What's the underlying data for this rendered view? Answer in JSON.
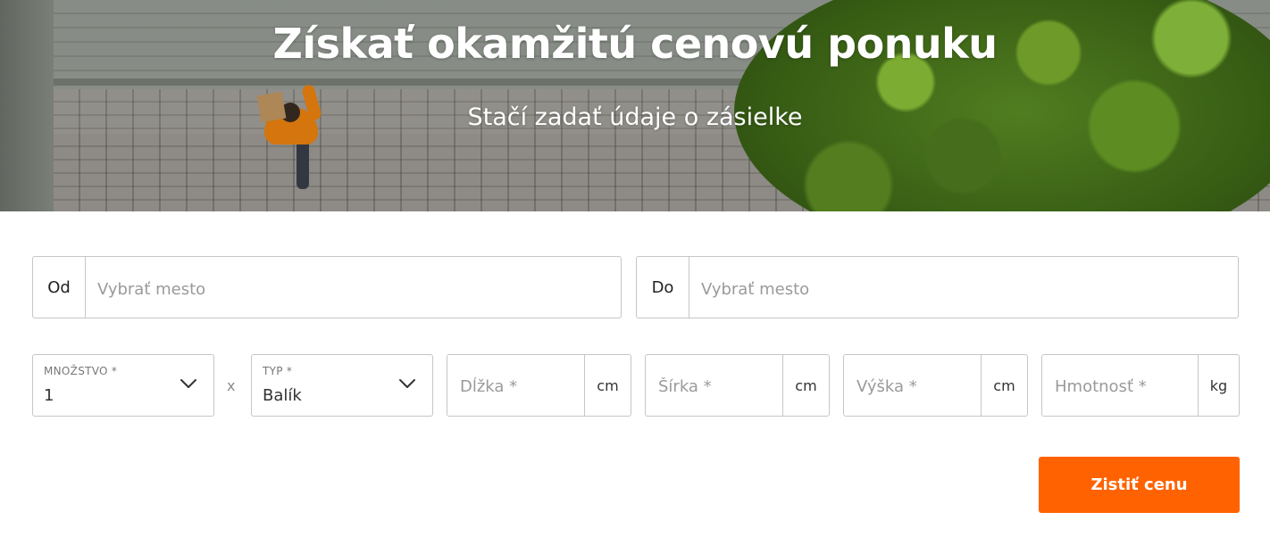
{
  "hero": {
    "title": "Získať okamžitú cenovú ponuku",
    "subtitle": "Stačí zadať údaje o zásielke"
  },
  "route": {
    "from": {
      "prefix": "Od",
      "placeholder": "Vybrať mesto",
      "value": ""
    },
    "to": {
      "prefix": "Do",
      "placeholder": "Vybrať mesto",
      "value": ""
    }
  },
  "parcel": {
    "quantity": {
      "label": "MNOŽSTVO *",
      "value": "1",
      "icon": "chevron-down-icon"
    },
    "multiplier": "x",
    "type": {
      "label": "TYP *",
      "value": "Balík",
      "icon": "chevron-down-icon"
    },
    "length": {
      "placeholder": "Dĺžka *",
      "unit": "cm"
    },
    "width": {
      "placeholder": "Šírka *",
      "unit": "cm"
    },
    "height": {
      "placeholder": "Výška *",
      "unit": "cm"
    },
    "weight": {
      "placeholder": "Hmotnosť *",
      "unit": "kg"
    }
  },
  "actions": {
    "submit_label": "Zistiť cenu"
  },
  "colors": {
    "accent": "#ff6200",
    "border": "#c6c6c6"
  }
}
